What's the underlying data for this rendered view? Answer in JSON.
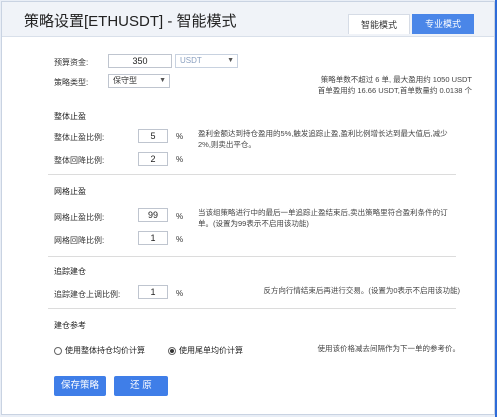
{
  "title": "策略设置[ETHUSDT] - 智能模式",
  "tabs": {
    "smart": "智能模式",
    "pro": "专业模式"
  },
  "budget": {
    "label": "预算资金:",
    "value": "350",
    "currency": "USDT"
  },
  "strategy_type": {
    "label": "策略类型:",
    "value": "保守型"
  },
  "info": {
    "line1": "策略单数不超过 6 单, 最大盈用约 1050 USDT",
    "line2": "首单盈用约 16.66 USDT,首单数量约 0.0138 个"
  },
  "overall_tp": {
    "title": "整体止盈",
    "ratio_label": "整体止盈比例:",
    "ratio_value": "5",
    "pullback_label": "整体回降比例:",
    "pullback_value": "2",
    "unit": "%",
    "desc": "盈利金额达到持仓盈用的5%,触发追踪止盈,盈利比例增长达到最大值后,减少2%,则卖出平仓。"
  },
  "grid_tp": {
    "title": "网格止盈",
    "ratio_label": "网格止盈比例:",
    "ratio_value": "99",
    "pullback_label": "网格回降比例:",
    "pullback_value": "1",
    "unit": "%",
    "desc": "当该组策略进行中的最后一单追踪止盈结束后,卖出策略里符合盈利条件的订单。(设置为99表示不启用该功能)"
  },
  "trail_add": {
    "title": "追踪建仓",
    "label": "追踪建仓上调比例:",
    "value": "1",
    "unit": "%",
    "desc": "反方向行情结束后再进行交易。(设置为0表示不启用该功能)"
  },
  "reference": {
    "title": "建仓参考",
    "option_avg": "使用整体持仓均价计算",
    "option_tail": "使用尾单均价计算",
    "selected": "tail",
    "desc": "使用该价格减去间隔作为下一单的参考价。"
  },
  "buttons": {
    "save": "保存策略",
    "reset": "还 原"
  }
}
